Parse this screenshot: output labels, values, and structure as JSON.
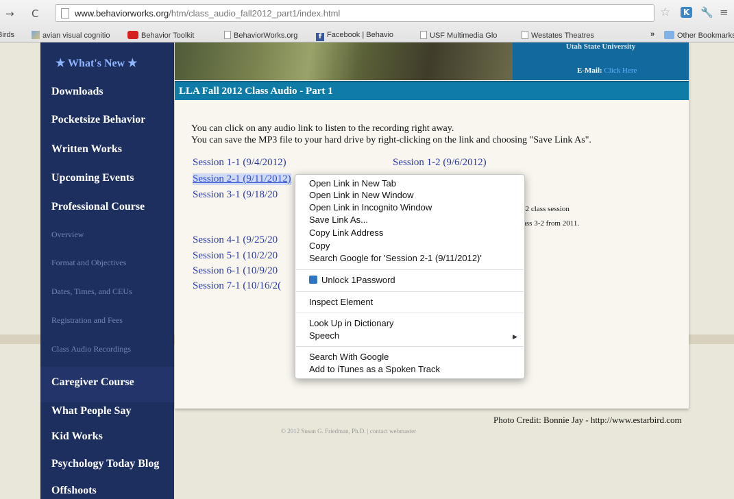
{
  "browser": {
    "back": "→",
    "reload": "C",
    "url_host": "www.behaviorworks.org",
    "url_path": "/htm/class_audio_fall2012_part1/index.html",
    "star": "☆",
    "extension": "K",
    "wrench": "🔧",
    "menu": "≡",
    "bookmarks": [
      "Birds",
      "avian visual cognitio",
      "Behavior Toolkit",
      "BehaviorWorks.org",
      "Facebook | Behavio",
      "USF Multimedia Glo",
      "Westates Theatres"
    ],
    "bookmarks_more": "»",
    "other_bookmarks": "Other Bookmarks"
  },
  "sidebar": {
    "whats_new": "★ What's New ★",
    "items": [
      "Downloads",
      "Pocketsize Behavior",
      "Written Works",
      "Upcoming Events",
      "Professional Course"
    ],
    "subitems": [
      "Overview",
      "Format and Objectives",
      "Dates, Times, and CEUs",
      "Registration and Fees",
      "Class Audio Recordings"
    ],
    "items_after": [
      "Caregiver Course",
      "What People Say",
      "Kid Works",
      "Psychology Today Blog",
      "Offshoots"
    ]
  },
  "header": {
    "university": "Utah State University",
    "email_label": "E-Mail:",
    "email_link": "Click Here",
    "title": "LLA Fall 2012 Class Audio - Part 1"
  },
  "content": {
    "intro_line1": "You can click on any audio link to listen to the recording right away.",
    "intro_line2": "You can save the MP3 file to your hard drive by right-clicking on the link and choosing \"Save Link As\".",
    "sessions_left": [
      "Session 1-1 (9/4/2012)",
      "Session 2-1 (9/11/2012)",
      "Session 3-1 (9/18/20",
      "Session 4-1 (9/25/20",
      "Session 5-1 (10/2/20",
      "Session 6-1 (10/9/20",
      "Session 7-1 (10/16/2("
    ],
    "sessions_right": [
      "Session 1-2 (9/6/2012)"
    ],
    "note1": "-2 class session",
    "note2": "ass 3-2 from 2011."
  },
  "footer": {
    "credit": "Photo Credit: Bonnie Jay - http://www.estarbird.com",
    "copyright": "© 2012 Susan G. Friedman, Ph.D.  |  contact webmaster"
  },
  "context_menu": {
    "items": [
      "Open Link in New Tab",
      "Open Link in New Window",
      "Open Link in Incognito Window",
      "Save Link As...",
      "Copy Link Address",
      "Copy",
      "Search Google for 'Session 2-1 (9/11/2012)'",
      "Unlock 1Password",
      "Inspect Element",
      "Look Up in Dictionary",
      "Speech",
      "Search With Google",
      "Add to iTunes as a Spoken Track"
    ],
    "submenu_arrow": "▶"
  }
}
